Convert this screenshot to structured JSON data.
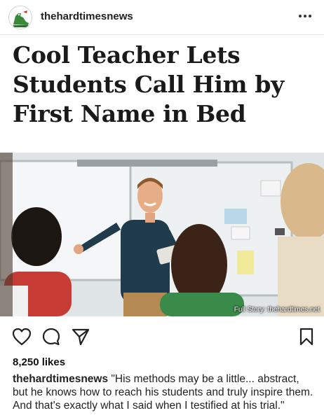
{
  "post": {
    "username": "thehardtimesnews",
    "avatar_icon": "dinosaur-logo-icon",
    "more_icon": "more-dots-icon",
    "headline": "Cool Teacher Lets Students Call Him by First Name in Bed",
    "image_caption": "Full Story: thehardtimes.net",
    "likes": "8,250 likes",
    "caption_user": "thehardtimesnews",
    "caption_text": "\"His methods may be a little... abstract, but he knows how to reach his students and truly inspire them. And that's exactly what I said when I testified at his trial.\""
  },
  "actions": {
    "like_icon": "heart-icon",
    "comment_icon": "comment-icon",
    "share_icon": "share-icon",
    "save_icon": "bookmark-icon"
  },
  "colors": {
    "accent_green": "#3a8a3a",
    "text": "#111111"
  }
}
